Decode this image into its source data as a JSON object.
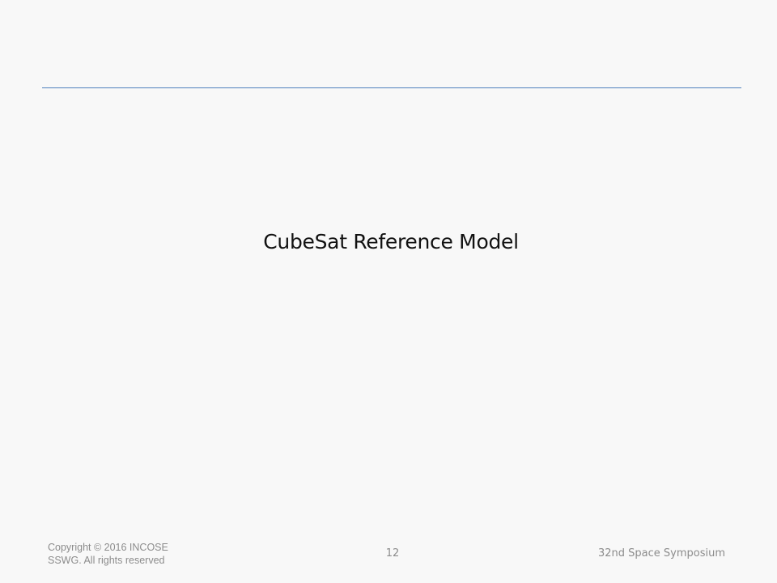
{
  "slide": {
    "title": "CubeSat Reference Model"
  },
  "footer": {
    "copyright": "Copyright © 2016 INCOSE SSWG. All rights reserved",
    "page_number": "12",
    "event": "32nd Space Symposium"
  },
  "colors": {
    "background": "#f8f8f8",
    "rule": "#4f81bd",
    "title_text": "#111111",
    "footer_text": "#8c8c8c"
  }
}
